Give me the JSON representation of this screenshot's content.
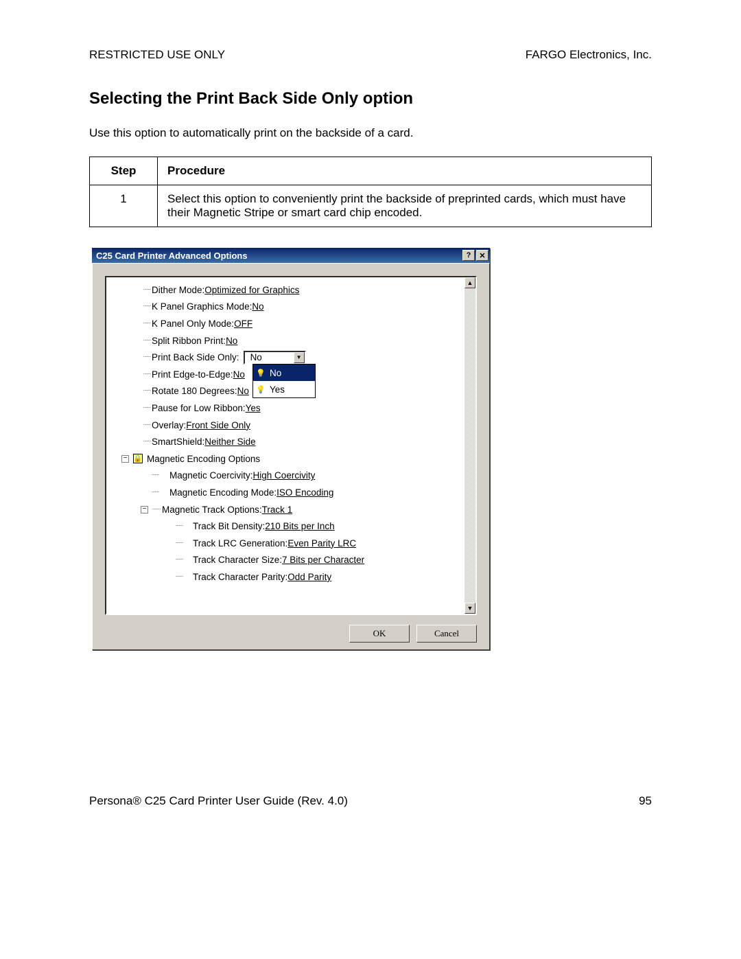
{
  "header": {
    "left": "RESTRICTED USE ONLY",
    "right": "FARGO Electronics, Inc."
  },
  "heading": "Selecting the Print Back Side Only option",
  "intro": "Use this option to automatically print on the backside of a card.",
  "table": {
    "col_step": "Step",
    "col_proc": "Procedure",
    "rows": [
      {
        "step": "1",
        "proc": "Select this option to conveniently print the backside of preprinted cards, which must have their Magnetic Stripe or smart card chip encoded."
      }
    ]
  },
  "dialog": {
    "title": "C25 Card Printer Advanced Options",
    "ok": "OK",
    "cancel": "Cancel",
    "combo": {
      "value": "No",
      "opt_no": "No",
      "opt_yes": "Yes"
    },
    "tree": {
      "dither": {
        "label": "Dither Mode: ",
        "value": "Optimized for Graphics"
      },
      "kpanel_graphics": {
        "label": "K Panel Graphics Mode: ",
        "value": "No"
      },
      "kpanel_only": {
        "label": "K Panel Only Mode: ",
        "value": "OFF"
      },
      "split_ribbon": {
        "label": "Split Ribbon Print: ",
        "value": "No"
      },
      "print_back": {
        "label": "Print Back Side Only: "
      },
      "edge_to_edge": {
        "label": "Print Edge-to-Edge: ",
        "value": "No"
      },
      "rotate180": {
        "label": "Rotate 180 Degrees: ",
        "value": "No"
      },
      "pause_low_ribbon": {
        "label": "Pause for Low Ribbon: ",
        "value": "Yes"
      },
      "overlay": {
        "label": "Overlay: ",
        "value": "Front Side Only"
      },
      "smartshield": {
        "label": "SmartShield: ",
        "value": "Neither Side"
      },
      "mag_options": {
        "label": "Magnetic Encoding Options"
      },
      "mag_coercivity": {
        "label": "Magnetic Coercivity: ",
        "value": "High Coercivity"
      },
      "mag_encoding_mode": {
        "label": "Magnetic Encoding Mode: ",
        "value": "ISO Encoding"
      },
      "mag_track_options": {
        "label": "Magnetic Track Options: ",
        "value": "Track 1"
      },
      "track_bit_density": {
        "label": "Track Bit Density: ",
        "value": "210 Bits per Inch"
      },
      "track_lrc": {
        "label": "Track LRC Generation: ",
        "value": "Even Parity LRC"
      },
      "track_char_size": {
        "label": "Track Character Size: ",
        "value": "7 Bits per Character"
      },
      "track_char_parity": {
        "label": "Track Character Parity: ",
        "value": "Odd Parity"
      }
    }
  },
  "footer": {
    "left": "Persona® C25 Card Printer User Guide (Rev. 4.0)",
    "right": "95"
  }
}
